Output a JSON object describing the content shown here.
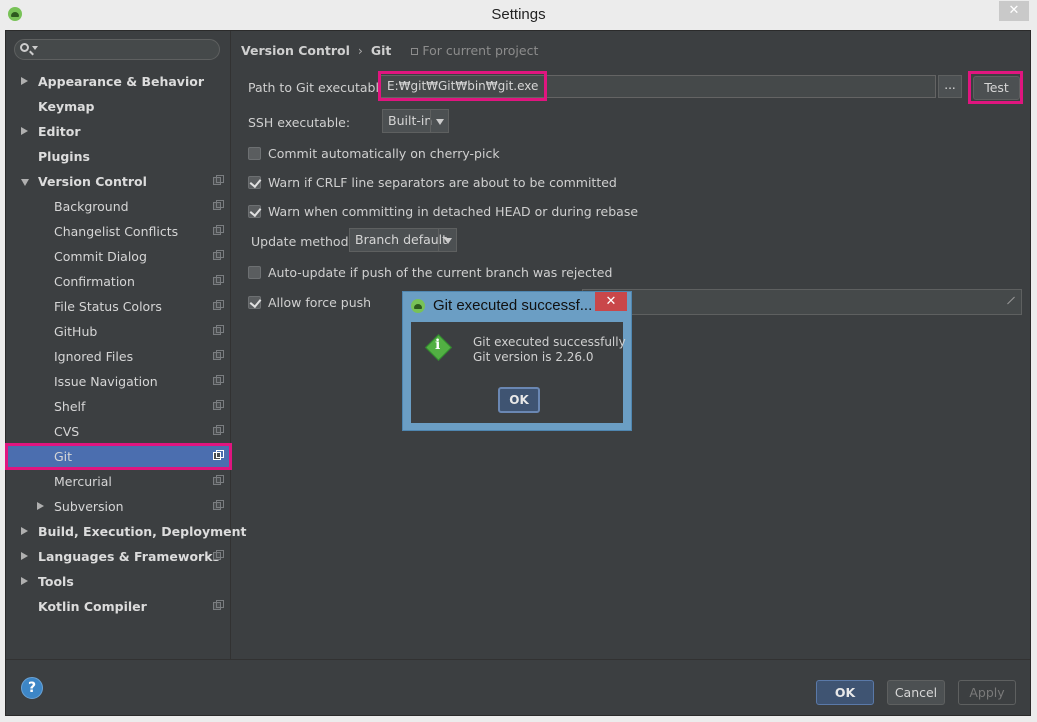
{
  "window": {
    "title": "Settings",
    "close_glyph": "✕"
  },
  "search": {
    "placeholder": ""
  },
  "sidebar": {
    "items": [
      {
        "label": "Appearance & Behavior",
        "bold": true,
        "expander": "right",
        "level": 0,
        "proj": false
      },
      {
        "label": "Keymap",
        "bold": true,
        "expander": "",
        "level": 0,
        "proj": false
      },
      {
        "label": "Editor",
        "bold": true,
        "expander": "right",
        "level": 0,
        "proj": false
      },
      {
        "label": "Plugins",
        "bold": true,
        "expander": "",
        "level": 0,
        "proj": false
      },
      {
        "label": "Version Control",
        "bold": true,
        "expander": "down",
        "level": 0,
        "proj": true
      },
      {
        "label": "Background",
        "bold": false,
        "expander": "",
        "level": 1,
        "proj": true
      },
      {
        "label": "Changelist Conflicts",
        "bold": false,
        "expander": "",
        "level": 1,
        "proj": true
      },
      {
        "label": "Commit Dialog",
        "bold": false,
        "expander": "",
        "level": 1,
        "proj": true
      },
      {
        "label": "Confirmation",
        "bold": false,
        "expander": "",
        "level": 1,
        "proj": true
      },
      {
        "label": "File Status Colors",
        "bold": false,
        "expander": "",
        "level": 1,
        "proj": true
      },
      {
        "label": "GitHub",
        "bold": false,
        "expander": "",
        "level": 1,
        "proj": true
      },
      {
        "label": "Ignored Files",
        "bold": false,
        "expander": "",
        "level": 1,
        "proj": true
      },
      {
        "label": "Issue Navigation",
        "bold": false,
        "expander": "",
        "level": 1,
        "proj": true
      },
      {
        "label": "Shelf",
        "bold": false,
        "expander": "",
        "level": 1,
        "proj": true
      },
      {
        "label": "CVS",
        "bold": false,
        "expander": "",
        "level": 1,
        "proj": true
      },
      {
        "label": "Git",
        "bold": false,
        "expander": "",
        "level": 1,
        "proj": true,
        "selected": true
      },
      {
        "label": "Mercurial",
        "bold": false,
        "expander": "",
        "level": 1,
        "proj": true
      },
      {
        "label": "Subversion",
        "bold": false,
        "expander": "right",
        "level": 1,
        "proj": true
      },
      {
        "label": "Build, Execution, Deployment",
        "bold": true,
        "expander": "right",
        "level": 0,
        "proj": false
      },
      {
        "label": "Languages & Frameworks",
        "bold": true,
        "expander": "right",
        "level": 0,
        "proj": true
      },
      {
        "label": "Tools",
        "bold": true,
        "expander": "right",
        "level": 0,
        "proj": false
      },
      {
        "label": "Kotlin Compiler",
        "bold": true,
        "expander": "",
        "level": 0,
        "proj": true
      }
    ]
  },
  "breadcrumb": {
    "parent": "Version Control",
    "separator": "›",
    "current": "Git",
    "scope": "For current project"
  },
  "git": {
    "path_label": "Path to Git executable:",
    "path_value": "E:₩git₩Git₩bin₩git.exe",
    "browse_label": "...",
    "test_label": "Test",
    "ssh_label": "SSH executable:",
    "ssh_value": "Built-in",
    "update_method_label": "Update method:",
    "update_method_value": "Branch default",
    "checkboxes": [
      {
        "label": "Commit automatically on cherry-pick",
        "checked": false
      },
      {
        "label": "Warn if CRLF line separators are about to be committed",
        "checked": true
      },
      {
        "label": "Warn when committing in detached HEAD or during rebase",
        "checked": true
      },
      {
        "label": "Auto-update if push of the current branch was rejected",
        "checked": false
      },
      {
        "label": "Allow force push",
        "checked": true
      }
    ]
  },
  "footer": {
    "ok": "OK",
    "cancel": "Cancel",
    "apply": "Apply",
    "help": "?"
  },
  "dialog": {
    "title": "Git executed successf...",
    "close_glyph": "✕",
    "line1": "Git executed successfully",
    "line2": "Git version is 2.26.0",
    "ok": "OK",
    "icon": "info-icon"
  }
}
